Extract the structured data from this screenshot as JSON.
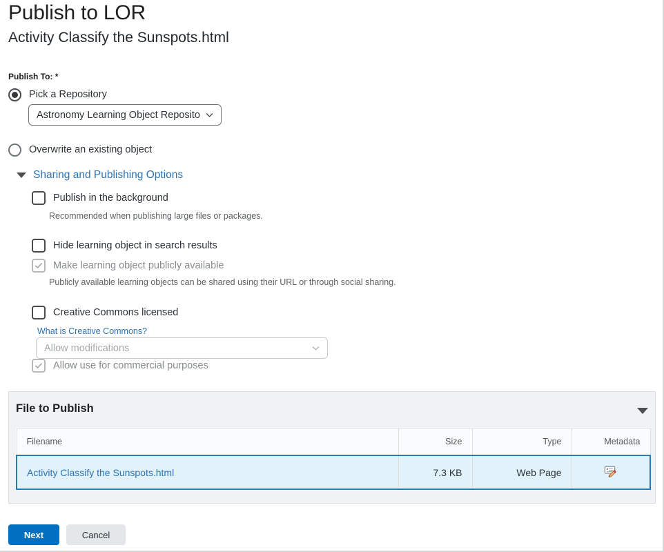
{
  "header": {
    "title": "Publish to LOR",
    "subtitle": "Activity Classify the Sunspots.html"
  },
  "form": {
    "publish_to_label": "Publish To:",
    "required_marker": "*",
    "radios": [
      {
        "label": "Pick a Repository",
        "selected": true
      },
      {
        "label": "Overwrite an existing object",
        "selected": false
      }
    ],
    "repository_select": {
      "value": "Astronomy Learning Object Repository",
      "chevron_icon": "chevron-down-icon"
    }
  },
  "sharing_section": {
    "toggle_label": "Sharing and Publishing Options",
    "expanded": true,
    "options": [
      {
        "label": "Publish in the background",
        "checked": false,
        "disabled": false,
        "help": "Recommended when publishing large files or packages."
      },
      {
        "label": "Hide learning object in search results",
        "checked": false,
        "disabled": false,
        "help": ""
      },
      {
        "label": "Make learning object publicly available",
        "checked": true,
        "disabled": true,
        "help": "Publicly available learning objects can be shared using their URL or through social sharing."
      },
      {
        "label": "Creative Commons licensed",
        "checked": false,
        "disabled": false,
        "help": ""
      }
    ],
    "cc_link": "What is Creative Commons?",
    "cc_modifications_select": {
      "value": "Allow modifications",
      "disabled": true,
      "chevron_icon": "chevron-down-icon"
    },
    "cc_commercial": {
      "label": "Allow use for commercial purposes",
      "checked": true,
      "disabled": true
    }
  },
  "file_panel": {
    "title": "File to Publish",
    "collapse_icon": "triangle-down-icon",
    "columns": [
      "Filename",
      "Size",
      "Type",
      "Metadata"
    ],
    "rows": [
      {
        "filename": "Activity Classify the Sunspots.html",
        "size": "7.3 KB",
        "type": "Web Page",
        "metadata_icon": "metadata-edit-icon",
        "selected": true
      }
    ]
  },
  "footer": {
    "next_label": "Next",
    "cancel_label": "Cancel"
  },
  "colors": {
    "primary_button": "#006fbf",
    "link": "#2c73b5",
    "selected_row_bg": "#e1f2fb",
    "selected_row_border": "#2a7bb0",
    "panel_bg": "#f1f2f4"
  }
}
